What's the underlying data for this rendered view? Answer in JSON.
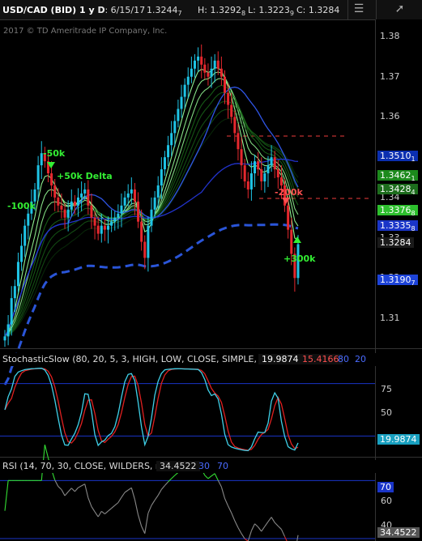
{
  "header": {
    "symbol": "USD/CAD (BID) 1 y D",
    "date": "D: 6/15/17",
    "high": "H: 1.3292",
    "high_sub": "8",
    "low": "L: 1.3223",
    "low_sub": "9",
    "close": "C: 1.3284",
    "open": "1.3244",
    "open_sub": "7",
    "copyright": "2017 © TD Ameritrade IP Company, Inc."
  },
  "price_labels": {
    "ticks": [
      "1.38",
      "1.37",
      "1.36",
      "1.35",
      "1.34",
      "1.33",
      "1.32",
      "1.31"
    ],
    "tags": [
      {
        "text": "1.3510",
        "sub": "1",
        "bg": "#0b2fb0",
        "fg": "#ffffff"
      },
      {
        "text": "1.3462",
        "sub": "1",
        "bg": "#1c8a1c",
        "fg": "#ffffff"
      },
      {
        "text": "1.3428",
        "sub": "4",
        "bg": "#1d6d1d",
        "fg": "#ffffff"
      },
      {
        "text": "1.3376",
        "sub": "8",
        "bg": "#2dbf2d",
        "fg": "#ffffff"
      },
      {
        "text": "1.3335",
        "sub": "8",
        "bg": "#1a35c8",
        "fg": "#ffffff"
      },
      {
        "text": "1.3284",
        "sub": "",
        "bg": "#1a1a1a",
        "fg": "#ffffff"
      },
      {
        "text": "1.3190",
        "sub": "7",
        "bg": "#1d43d8",
        "fg": "#ffffff"
      }
    ]
  },
  "annotations": [
    {
      "text": "-100k",
      "color": "#33ee33"
    },
    {
      "text": "-50k",
      "color": "#33ee33"
    },
    {
      "text": "+50k Delta",
      "color": "#33ee33"
    },
    {
      "text": "-200k",
      "color": "#ff5050"
    },
    {
      "text": "+300k",
      "color": "#33ee33"
    }
  ],
  "stochastic": {
    "title": "StochasticSlow (80, 20, 5, 3, HIGH, LOW, CLOSE, SIMPLE, No)",
    "k_value": "19.9874",
    "d_value": "15.4166",
    "ob": "80",
    "os": "20",
    "ticks": [
      "75",
      "50"
    ],
    "tag": "19.9874"
  },
  "rsi": {
    "title": "RSI (14, 70, 30, CLOSE, WILDERS, no)",
    "value": "34.4522",
    "ob": "30",
    "os": "70",
    "ticks": [
      "60",
      "40"
    ],
    "tag_70": "70",
    "tag_val": "34.4522"
  },
  "colors": {
    "up": "#1fc4e6",
    "down": "#e6282e",
    "ema_dark": "#1b6e1b",
    "ema_light": "#8ff08f",
    "sma_blue": "#2233cc",
    "sma_dash": "#2a55d8",
    "grid_line": "#1a3bd8"
  },
  "chart_data": {
    "type": "candlestick",
    "title": "USD/CAD (BID) 1 y D",
    "ylim": [
      1.303,
      1.386
    ],
    "closes": [
      1.3055,
      1.3085,
      1.315,
      1.318,
      1.324,
      1.328,
      1.333,
      1.336,
      1.339,
      1.342,
      1.348,
      1.351,
      1.349,
      1.346,
      1.343,
      1.34,
      1.338,
      1.337,
      1.335,
      1.337,
      1.339,
      1.338,
      1.34,
      1.341,
      1.342,
      1.338,
      1.335,
      1.333,
      1.331,
      1.333,
      1.332,
      1.333,
      1.334,
      1.335,
      1.336,
      1.338,
      1.34,
      1.341,
      1.342,
      1.339,
      1.334,
      1.329,
      1.325,
      1.333,
      1.337,
      1.34,
      1.343,
      1.347,
      1.35,
      1.353,
      1.356,
      1.359,
      1.362,
      1.365,
      1.368,
      1.37,
      1.372,
      1.374,
      1.375,
      1.373,
      1.371,
      1.37,
      1.372,
      1.374,
      1.372,
      1.37,
      1.366,
      1.363,
      1.36,
      1.356,
      1.352,
      1.348,
      1.344,
      1.342,
      1.346,
      1.349,
      1.347,
      1.344,
      1.346,
      1.348,
      1.35,
      1.347,
      1.345,
      1.343,
      1.338,
      1.332,
      1.326,
      1.32,
      1.3284
    ],
    "stochastic_k_range": [
      0,
      100
    ],
    "rsi_range": [
      30,
      75
    ]
  }
}
